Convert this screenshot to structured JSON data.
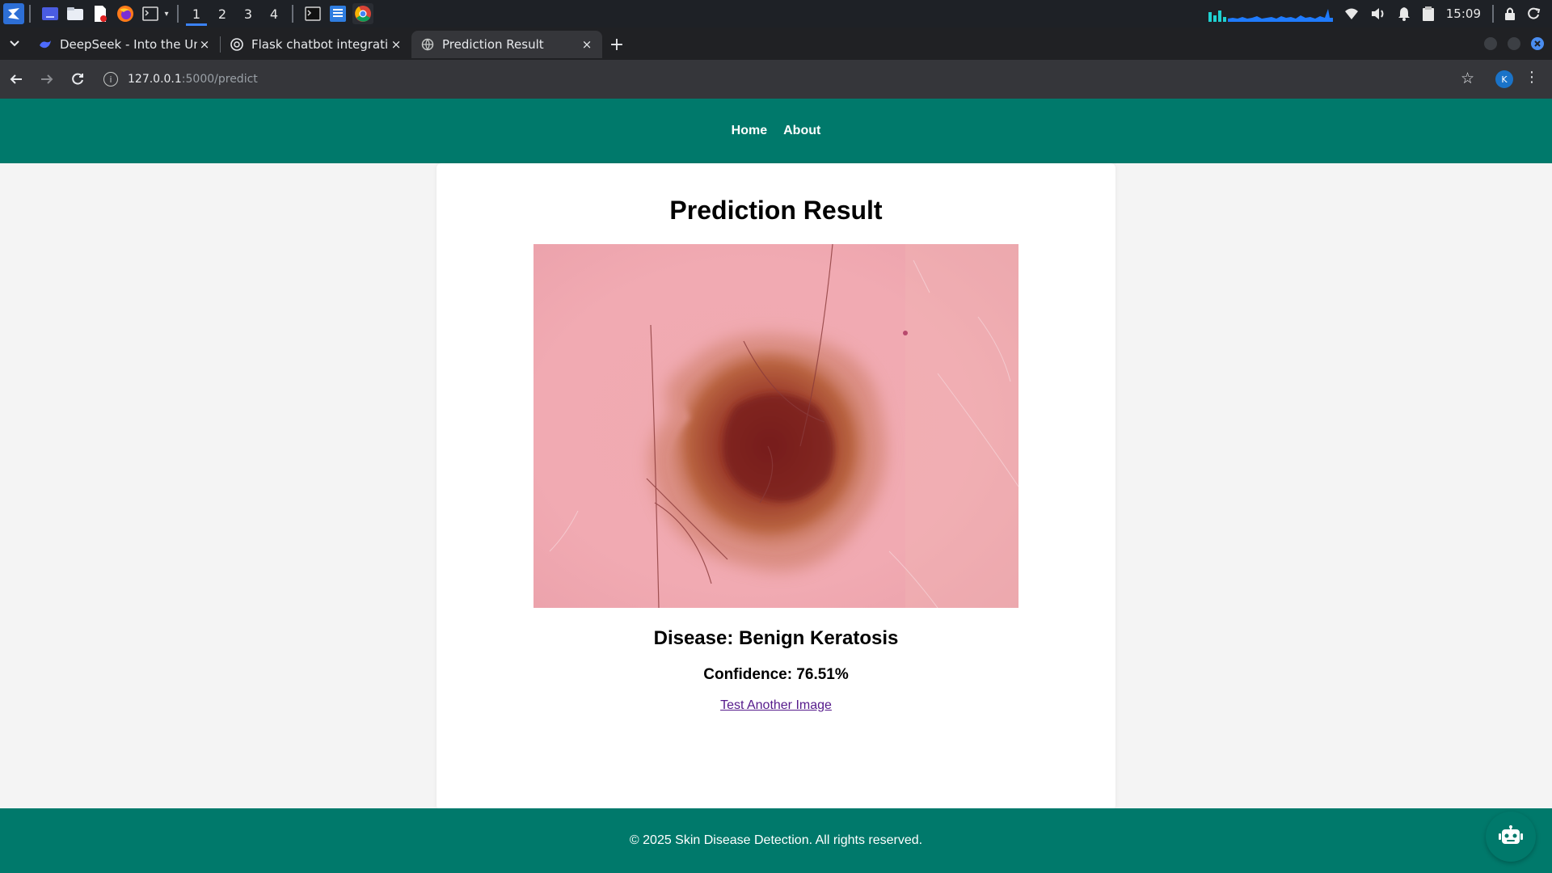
{
  "taskbar": {
    "workspaces": [
      "1",
      "2",
      "3",
      "4"
    ],
    "active_workspace": "1",
    "clock": "15:09",
    "icons": [
      "app-menu-icon",
      "desktop-icon",
      "file-manager-icon",
      "text-editor-icon",
      "firefox-icon",
      "terminal-icon",
      "dropdown-icon",
      "terminal2-icon",
      "notes-icon",
      "chrome-icon"
    ],
    "tray": [
      "network-graph",
      "wifi-icon",
      "volume-icon",
      "bell-icon",
      "clipboard-icon",
      "lock-icon",
      "power-icon"
    ]
  },
  "browser": {
    "tabs": [
      {
        "title": "DeepSeek - Into the Unkn",
        "favicon": "deepseek-icon",
        "active": false
      },
      {
        "title": "Flask chatbot integration",
        "favicon": "chatgpt-icon",
        "active": false
      },
      {
        "title": "Prediction Result",
        "favicon": "globe-icon",
        "active": true
      }
    ],
    "close_glyph": "×",
    "new_tab_glyph": "+",
    "url_host": "127.0.0.1",
    "url_path": ":5000/predict",
    "profile_initial": "K"
  },
  "site": {
    "nav": [
      "Home",
      "About"
    ],
    "heading": "Prediction Result",
    "disease_text": "Disease: Benign Keratosis",
    "confidence_text": "Confidence: 76.51%",
    "retest_link": "Test Another Image",
    "footer": "© 2025 Skin Disease Detection. All rights reserved.",
    "colors": {
      "primary": "#00796b",
      "page_bg": "#f4f4f4",
      "link": "#551a8b"
    }
  }
}
